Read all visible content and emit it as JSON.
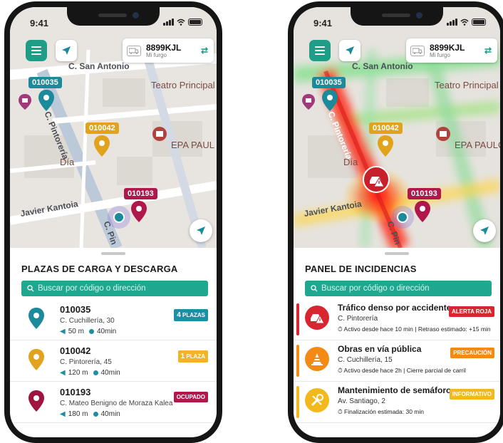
{
  "status": {
    "time": "9:41"
  },
  "vehicle": {
    "plate": "8899KJL",
    "name": "Mi furgo"
  },
  "map": {
    "streets": [
      "C. San Antonio",
      "C. Pintorería",
      "Javier Kantoia",
      "C. Pin"
    ],
    "pois": [
      "Teatro Principal",
      "EPA PAUL",
      "Día"
    ],
    "right_poi": "EPA PAULO",
    "pins": [
      {
        "code": "010035",
        "color": "#1b8a9a"
      },
      {
        "code": "010042",
        "color": "#e2a31c"
      },
      {
        "code": "010193",
        "color": "#b0174a"
      }
    ]
  },
  "left": {
    "title": "PLAZAS DE CARGA Y DESCARGA",
    "search_placeholder": "Buscar por código o dirección",
    "items": [
      {
        "code": "010035",
        "address": "C. Cuchillería, 30",
        "distance": "50 m",
        "time": "40min",
        "badge_num": "4",
        "badge_text": "PLAZAS",
        "badge_color": "#1a8fa6",
        "pin_color": "#1b8a9a"
      },
      {
        "code": "010042",
        "address": "C. Pintorería, 45",
        "distance": "120 m",
        "time": "40min",
        "badge_num": "1",
        "badge_text": "PLAZA",
        "badge_color": "#f0b429",
        "pin_color": "#e2a31c"
      },
      {
        "code": "010193",
        "address": "C. Mateo Benigno de Moraza Kalea",
        "distance": "180 m",
        "time": "40min",
        "badge_num": "",
        "badge_text": "OCUPADO",
        "badge_color": "#b0174a",
        "pin_color": "#9e1540"
      }
    ]
  },
  "right": {
    "title": "PANEL DE INCIDENCIAS",
    "search_placeholder": "Buscar por código o dirección",
    "items": [
      {
        "title": "Tráfico denso por accidente",
        "street": "C. Pintorería",
        "detail": "Activo desde hace 10 min | Retraso estimado: +15 min",
        "badge": "ALERTA ROJA",
        "color": "#d7262f"
      },
      {
        "title": "Obras en vía pública",
        "street": "C. Cuchillería, 15",
        "detail": "Activo desde hace 2h | Cierre parcial de carril",
        "badge": "PRECAUCIÓN",
        "color": "#f28a14"
      },
      {
        "title": "Mantenimiento de semáforo",
        "street": "Av. Santiago, 2",
        "detail": "Finalización estimada: 30 min",
        "badge": "INFORMATIVO",
        "color": "#f3b81c"
      }
    ]
  }
}
